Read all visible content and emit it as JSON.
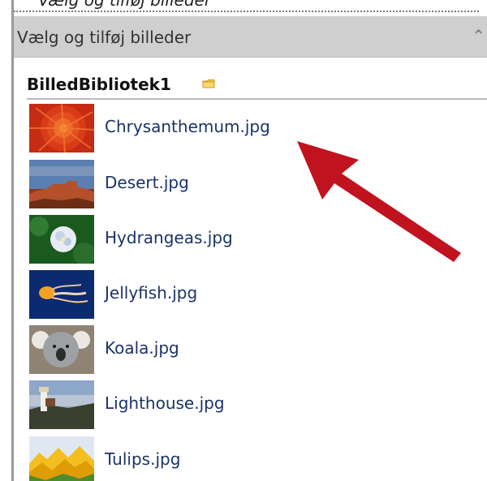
{
  "panel": {
    "title": "Vælg og tilføj billeder",
    "top_cut_text": "Vælg og tilføj billeder",
    "collapse_icon": "double-chevron-up-icon"
  },
  "library": {
    "name": "BilledBibliotek1",
    "icon": "folder-icon"
  },
  "items": [
    {
      "label": "Chrysanthemum.jpg",
      "thumb": "chrysanthemum-thumbnail"
    },
    {
      "label": "Desert.jpg",
      "thumb": "desert-thumbnail"
    },
    {
      "label": "Hydrangeas.jpg",
      "thumb": "hydrangeas-thumbnail"
    },
    {
      "label": "Jellyfish.jpg",
      "thumb": "jellyfish-thumbnail"
    },
    {
      "label": "Koala.jpg",
      "thumb": "koala-thumbnail"
    },
    {
      "label": "Lighthouse.jpg",
      "thumb": "lighthouse-thumbnail"
    },
    {
      "label": "Tulips.jpg",
      "thumb": "tulips-thumbnail"
    }
  ],
  "colors": {
    "header_bg": "#cfcfcf",
    "link": "#1a3366",
    "arrow": "#c1121f"
  }
}
